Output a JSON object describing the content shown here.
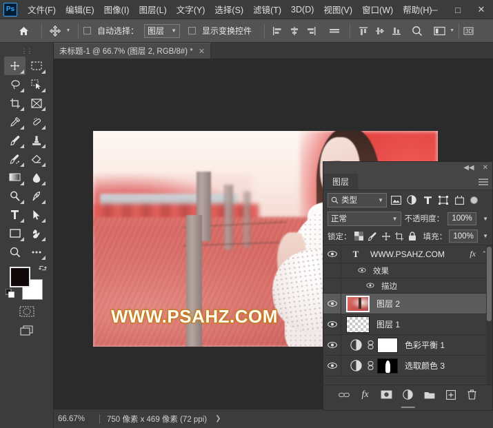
{
  "app": {
    "logo_text": "Ps"
  },
  "menubar": {
    "items": [
      {
        "label": "文件(F)"
      },
      {
        "label": "编辑(E)"
      },
      {
        "label": "图像(I)"
      },
      {
        "label": "图层(L)"
      },
      {
        "label": "文字(Y)"
      },
      {
        "label": "选择(S)"
      },
      {
        "label": "滤镜(T)"
      },
      {
        "label": "3D(D)"
      },
      {
        "label": "视图(V)"
      },
      {
        "label": "窗口(W)"
      },
      {
        "label": "帮助(H)"
      }
    ],
    "window_controls": {
      "minimize": "─",
      "maximize": "□",
      "close": "✕"
    }
  },
  "options_bar": {
    "home_icon": "home-icon",
    "tool_icon": "move-tool-icon",
    "auto_select_label": "自动选择：",
    "auto_select_checked": false,
    "layer_dropdown_value": "图层",
    "show_transform_label": "显示变换控件",
    "show_transform_checked": false,
    "align_icons": [
      "align-left-icon",
      "align-center-horizontal-icon",
      "align-right-icon",
      "distribute-horizontal-icon"
    ],
    "distribute_icons": [
      "align-top-icon",
      "align-center-vertical-icon",
      "align-bottom-icon"
    ],
    "search_icon": "search-icon",
    "arrange_icon": "arrange-documents-icon",
    "threed_icon": "3d-mode-icon"
  },
  "document_tab": {
    "title": "未标题-1 @ 66.7% (图层 2, RGB/8#) *",
    "close_icon": "close-icon"
  },
  "toolbar": {
    "grip": "⋮⋮",
    "tools_left": [
      {
        "name": "move-tool",
        "icon": "move-icon",
        "active": true
      },
      {
        "name": "lasso-tool",
        "icon": "lasso-icon",
        "active": false
      },
      {
        "name": "crop-tool",
        "icon": "crop-icon",
        "active": false
      },
      {
        "name": "eyedropper-tool",
        "icon": "eyedropper-icon",
        "active": false
      },
      {
        "name": "brush-tool",
        "icon": "brush-icon",
        "active": false
      },
      {
        "name": "history-brush-tool",
        "icon": "history-brush-icon",
        "active": false
      },
      {
        "name": "gradient-tool",
        "icon": "gradient-icon",
        "active": false
      },
      {
        "name": "dodge-tool",
        "icon": "dodge-icon",
        "active": false
      },
      {
        "name": "type-tool",
        "icon": "type-icon",
        "active": false
      },
      {
        "name": "rectangle-tool",
        "icon": "rectangle-icon",
        "active": false
      },
      {
        "name": "zoom-tool",
        "icon": "zoom-icon",
        "active": false
      }
    ],
    "tools_right": [
      {
        "name": "marquee-tool",
        "icon": "marquee-icon",
        "active": false
      },
      {
        "name": "quick-selection-tool",
        "icon": "quick-selection-icon",
        "active": false
      },
      {
        "name": "frame-tool",
        "icon": "frame-icon",
        "active": false
      },
      {
        "name": "healing-brush-tool",
        "icon": "healing-brush-icon",
        "active": false
      },
      {
        "name": "clone-stamp-tool",
        "icon": "clone-stamp-icon",
        "active": false
      },
      {
        "name": "eraser-tool",
        "icon": "eraser-icon",
        "active": false
      },
      {
        "name": "blur-tool",
        "icon": "blur-icon",
        "active": false
      },
      {
        "name": "pen-tool",
        "icon": "pen-icon",
        "active": false
      },
      {
        "name": "path-selection-tool",
        "icon": "path-selection-icon",
        "active": false
      },
      {
        "name": "hand-tool",
        "icon": "hand-icon",
        "active": false
      },
      {
        "name": "edit-toolbar",
        "icon": "ellipsis-icon",
        "active": false
      }
    ],
    "foreground_color": "#0f0708",
    "background_color": "#ffffff",
    "swap_icon": "swap-colors-icon",
    "default_icon": "default-colors-icon",
    "quick_mask_icon": "quick-mask-icon",
    "screen_mode_icon": "screen-mode-icon"
  },
  "canvas": {
    "watermark_text": "WWW.PSAHZ.COM",
    "watermark_fill": "#fffdf2",
    "watermark_stroke": "#c9851f"
  },
  "status_bar": {
    "zoom": "66.67%",
    "dimensions": "750 像素 x 469 像素 (72 ppi)",
    "expand_icon": "chevron-right-icon"
  },
  "layers_panel": {
    "collapse_icon": "collapse-icon",
    "close_icon": "close-icon",
    "tab_label": "图层",
    "menu_icon": "panel-menu-icon",
    "filter": {
      "search_icon": "search-icon",
      "type_label": "类型",
      "icons": [
        "pixel-filter-icon",
        "adjustment-filter-icon",
        "type-filter-icon",
        "shape-filter-icon",
        "smart-object-filter-icon"
      ],
      "toggle_icon": "filter-toggle-icon"
    },
    "blend_mode": "正常",
    "opacity_label": "不透明度：",
    "opacity_value": "100%",
    "lock_label": "锁定：",
    "lock_icons": [
      "lock-transparent-icon",
      "lock-image-icon",
      "lock-position-icon",
      "lock-artboard-icon",
      "lock-all-icon"
    ],
    "fill_label": "填充：",
    "fill_value": "100%",
    "layers": [
      {
        "name": "WWW.PSAHZ.COM",
        "kind": "type",
        "thumb": "type-icon",
        "visible": true,
        "selected": false,
        "has_fx": true,
        "fx_badge": "fx",
        "chevron": "⌃"
      },
      {
        "name": "效果",
        "kind": "effects-group",
        "visible": true,
        "indent": 1
      },
      {
        "name": "描边",
        "kind": "effect",
        "visible": true,
        "indent": 2
      },
      {
        "name": "图层 2",
        "kind": "pixel",
        "thumb": "photo-thumbnail",
        "visible": true,
        "selected": true
      },
      {
        "name": "图层 1",
        "kind": "pixel",
        "thumb": "transparent-thumbnail",
        "visible": true,
        "selected": false
      },
      {
        "name": "色彩平衡 1",
        "kind": "adjustment",
        "thumb": "color-balance-icon",
        "mask": "white-mask",
        "link": "link-icon",
        "visible": true,
        "selected": false
      },
      {
        "name": "选取颜色 3",
        "kind": "adjustment",
        "thumb": "selective-color-icon",
        "mask": "black-mask-with-figure",
        "link": "link-icon",
        "visible": true,
        "selected": false
      }
    ],
    "footer_icons": [
      {
        "name": "link-layers-icon",
        "glyph": "🔗"
      },
      {
        "name": "layer-style-fx-icon",
        "glyph": "fx"
      },
      {
        "name": "add-layer-mask-icon",
        "glyph": "◉"
      },
      {
        "name": "new-adjustment-layer-icon",
        "glyph": "◐"
      },
      {
        "name": "new-group-icon",
        "glyph": "▭"
      },
      {
        "name": "new-layer-icon",
        "glyph": "+"
      },
      {
        "name": "delete-layer-icon",
        "glyph": "🗑"
      }
    ],
    "scroll_position": "top"
  }
}
